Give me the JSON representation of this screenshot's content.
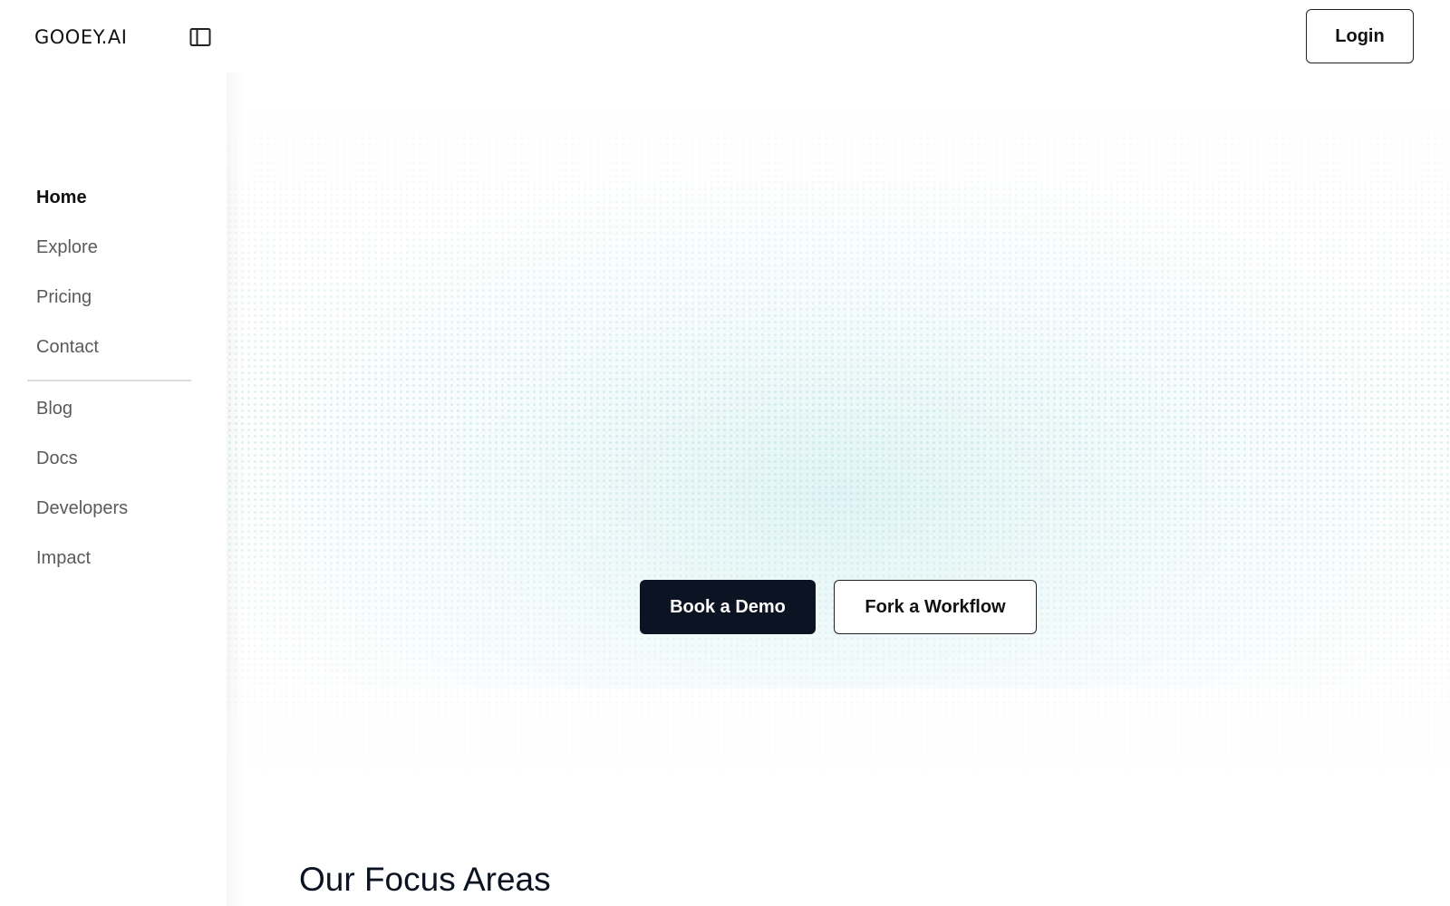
{
  "header": {
    "logo_text": "GOOEY.AI",
    "sidebar_toggle_icon": "sidebar-panel-icon",
    "login_label": "Login"
  },
  "sidebar": {
    "primary_items": [
      {
        "label": "Home",
        "active": true
      },
      {
        "label": "Explore",
        "active": false
      },
      {
        "label": "Pricing",
        "active": false
      },
      {
        "label": "Contact",
        "active": false
      }
    ],
    "secondary_items": [
      {
        "label": "Blog"
      },
      {
        "label": "Docs"
      },
      {
        "label": "Developers"
      },
      {
        "label": "Impact"
      }
    ]
  },
  "hero": {
    "primary_cta": "Book a Demo",
    "secondary_cta": "Fork a Workflow"
  },
  "section": {
    "title": "Our Focus Areas"
  },
  "colors": {
    "primary_button_bg": "#0c1322",
    "accent_tint": "#c8ebec",
    "nav_active": "#111111",
    "nav_inactive": "#5a5a5a"
  }
}
